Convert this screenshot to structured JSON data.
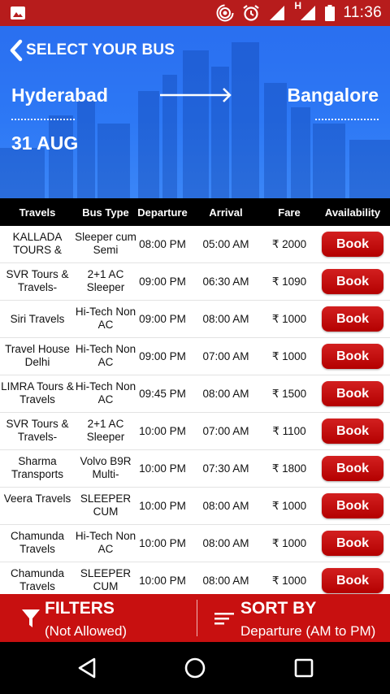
{
  "status_bar": {
    "time": "11:36",
    "network_label": "H"
  },
  "header": {
    "back_title": "SELECT YOUR BUS",
    "from_city": "Hyderabad",
    "to_city": "Bangalore",
    "date": "31 AUG"
  },
  "table": {
    "columns": [
      "Travels",
      "Bus Type",
      "Departure",
      "Arrival",
      "Fare",
      "Availability"
    ],
    "rows": [
      {
        "travels": "KALLADA TOURS &",
        "type": "Sleeper cum Semi",
        "departure": "08:00 PM",
        "arrival": "05:00 AM",
        "fare": "₹ 2000",
        "action": "Book"
      },
      {
        "travels": "SVR Tours & Travels-",
        "type": "2+1 AC Sleeper",
        "departure": "09:00 PM",
        "arrival": "06:30 AM",
        "fare": "₹ 1090",
        "action": "Book"
      },
      {
        "travels": "Siri Travels",
        "type": "Hi-Tech Non AC",
        "departure": "09:00 PM",
        "arrival": "08:00 AM",
        "fare": "₹ 1000",
        "action": "Book"
      },
      {
        "travels": "Travel House Delhi",
        "type": "Hi-Tech Non AC",
        "departure": "09:00 PM",
        "arrival": "07:00 AM",
        "fare": "₹ 1000",
        "action": "Book"
      },
      {
        "travels": "LIMRA Tours & Travels",
        "type": "Hi-Tech Non AC",
        "departure": "09:45 PM",
        "arrival": "08:00 AM",
        "fare": "₹ 1500",
        "action": "Book"
      },
      {
        "travels": "SVR Tours & Travels-",
        "type": "2+1 AC Sleeper",
        "departure": "10:00 PM",
        "arrival": "07:00 AM",
        "fare": "₹ 1100",
        "action": "Book"
      },
      {
        "travels": "Sharma Transports",
        "type": "Volvo B9R Multi-",
        "departure": "10:00 PM",
        "arrival": "07:30 AM",
        "fare": "₹ 1800",
        "action": "Book"
      },
      {
        "travels": "Veera Travels",
        "type": "SLEEPER CUM",
        "departure": "10:00 PM",
        "arrival": "08:00 AM",
        "fare": "₹ 1000",
        "action": "Book"
      },
      {
        "travels": "Chamunda Travels",
        "type": "Hi-Tech Non AC",
        "departure": "10:00 PM",
        "arrival": "08:00 AM",
        "fare": "₹ 1000",
        "action": "Book"
      },
      {
        "travels": "Chamunda Travels",
        "type": "SLEEPER CUM",
        "departure": "10:00 PM",
        "arrival": "08:00 AM",
        "fare": "₹ 1000",
        "action": "Book"
      }
    ]
  },
  "bottom_bar": {
    "filters_label": "FILTERS",
    "filters_sub": "(Not Allowed)",
    "sort_label": "SORT BY",
    "sort_sub": "Departure (AM to PM)"
  },
  "colors": {
    "status_bar": "#b71c1c",
    "header_blue": "#2d78f5",
    "book_red": "#c40a0a",
    "bottom_bar": "#c81010"
  },
  "icons": {
    "status": [
      "image-notification-icon",
      "hotspot-icon",
      "alarm-icon",
      "signal-icon",
      "signal-h-icon",
      "battery-icon"
    ],
    "nav": [
      "back-nav-icon",
      "home-nav-icon",
      "recents-nav-icon"
    ]
  }
}
